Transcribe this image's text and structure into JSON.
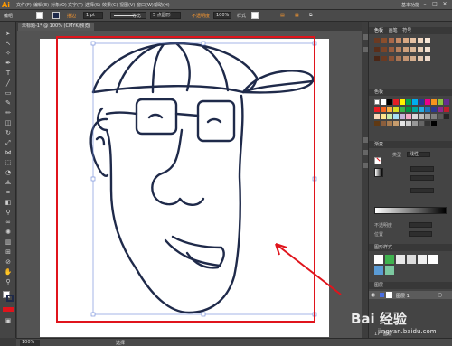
{
  "app": {
    "logo": "Ai",
    "workspace": "基本功能"
  },
  "menu": [
    "文件(F)",
    "编辑(E)",
    "对象(O)",
    "文字(T)",
    "选择(S)",
    "效果(C)",
    "视图(V)",
    "窗口(W)",
    "帮助(H)"
  ],
  "control": {
    "selection_label": "编组",
    "stroke_label": "描边",
    "stroke_weight": "1 pt",
    "profile_label": "等比",
    "brush_value": "5 点圆形",
    "opacity_label": "不透明度",
    "opacity_value": "100%",
    "style_label": "样式"
  },
  "document": {
    "tab": "未标题-1* @ 100% (CMYK/预览)"
  },
  "panels": {
    "swatch_tabs": [
      "色板",
      "画笔",
      "符号"
    ],
    "swatches_head": "色板",
    "gradient_head": "渐变",
    "gradient_type_label": "类型",
    "gradient_type": "线性",
    "stroke_label": "描边",
    "opacity_label": "不透明度",
    "position_label": "位置",
    "graphic_styles_head": "图形样式",
    "layers_head": "图层",
    "layers_row": "图层 1",
    "layers_count": "1 个图层"
  },
  "status": {
    "zoom": "100%",
    "mode": "选择"
  },
  "colors": {
    "accent": "#ff9a00",
    "frame": "#e0141c",
    "arrow": "#e0141c",
    "stroke": "#1f2a4a"
  },
  "watermark": {
    "main": "Bai 经验",
    "sub": "jingyan.baidu.com"
  }
}
